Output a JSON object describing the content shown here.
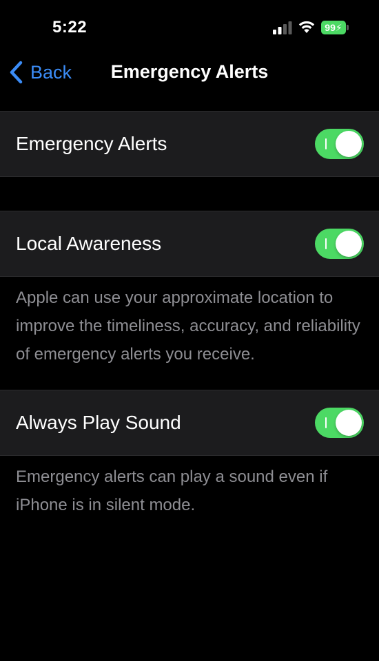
{
  "status_bar": {
    "time": "5:22",
    "battery_level": "99",
    "battery_color": "#4cd964",
    "icons": [
      "signal-icon",
      "wifi-icon",
      "battery-icon"
    ]
  },
  "nav": {
    "back_label": "Back",
    "title": "Emergency Alerts",
    "accent_color": "#3b8cf6"
  },
  "settings": {
    "emergency_alerts": {
      "label": "Emergency Alerts",
      "enabled": true
    },
    "local_awareness": {
      "label": "Local Awareness",
      "enabled": true,
      "footnote": "Apple can use your approximate location to improve the timeliness, accuracy, and reliability of emergency alerts you receive."
    },
    "always_play_sound": {
      "label": "Always Play Sound",
      "enabled": true,
      "footnote": "Emergency alerts can play a sound even if iPhone is in silent mode."
    }
  },
  "colors": {
    "background": "#000000",
    "cell_background": "#1c1c1e",
    "toggle_on": "#4cd964",
    "footnote_text": "#8e8e93"
  }
}
